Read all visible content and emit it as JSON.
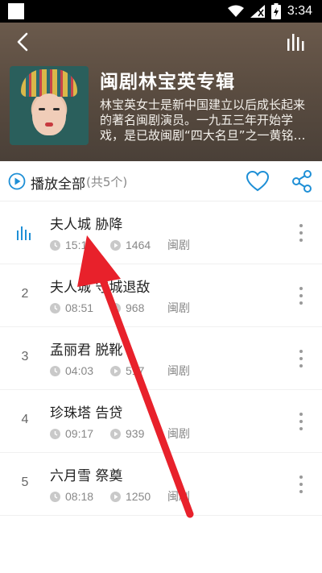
{
  "status_bar": {
    "time": "3:34",
    "icons": [
      "wifi-icon",
      "signal-icon",
      "battery-charging-icon"
    ]
  },
  "header": {
    "back_icon": "back-arrow-icon",
    "player_icon": "equalizer-icon",
    "album_title": "闽剧林宝英专辑",
    "album_description": "林宝英女士是新中国建立以后成长起来的著名闽剧演员。一九五三年开始学戏，是已故闽剧“四大名旦”之一黄铭卿..."
  },
  "play_all": {
    "label": "播放全部",
    "count": "(共5个)",
    "accent_color": "#1e8fd6"
  },
  "tracks": [
    {
      "index": "",
      "playing": true,
      "title": "夫人城 胁降",
      "duration": "15:10",
      "plays": "1464",
      "tag": "闽剧"
    },
    {
      "index": "2",
      "playing": false,
      "title": "夫人城 守城退敌",
      "duration": "08:51",
      "plays": "968",
      "tag": "闽剧"
    },
    {
      "index": "3",
      "playing": false,
      "title": "孟丽君 脱靴",
      "duration": "04:03",
      "plays": "517",
      "tag": "闽剧"
    },
    {
      "index": "4",
      "playing": false,
      "title": "珍珠塔 告贷",
      "duration": "09:17",
      "plays": "939",
      "tag": "闽剧"
    },
    {
      "index": "5",
      "playing": false,
      "title": "六月雪 祭奠",
      "duration": "08:18",
      "plays": "1250",
      "tag": "闽剧"
    }
  ],
  "colors": {
    "header_bg": "#5b4d41",
    "accent": "#1e8fd6",
    "annotation_arrow": "#e8212b"
  }
}
